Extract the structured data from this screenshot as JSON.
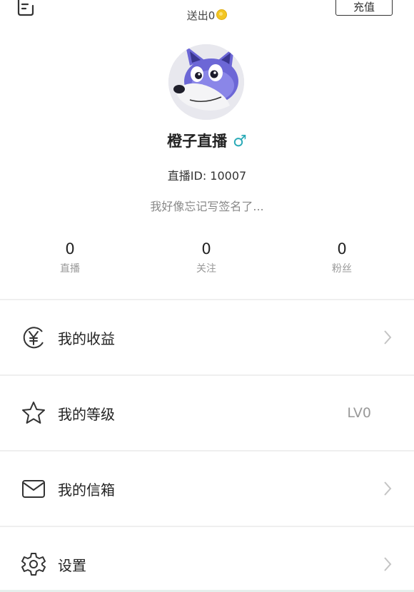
{
  "header": {
    "sent_label": "送出0",
    "recharge_label": "充值"
  },
  "profile": {
    "nickname": "橙子直播",
    "gender_symbol": "♂",
    "live_id": "直播ID: 10007",
    "signature": "我好像忘记写签名了..."
  },
  "stats": [
    {
      "value": "0",
      "label": "直播"
    },
    {
      "value": "0",
      "label": "关注"
    },
    {
      "value": "0",
      "label": "粉丝"
    }
  ],
  "menu": [
    {
      "label": "我的收益",
      "icon": "yuan-circle-icon"
    },
    {
      "label": "我的等级",
      "icon": "star-icon",
      "value": "LV0"
    },
    {
      "label": "我的信箱",
      "icon": "mail-icon"
    },
    {
      "label": "设置",
      "icon": "gear-icon"
    }
  ],
  "colors": {
    "gender": "#29aab7",
    "coin": "#f3c623",
    "avatar_fur": "#6c67d6"
  }
}
